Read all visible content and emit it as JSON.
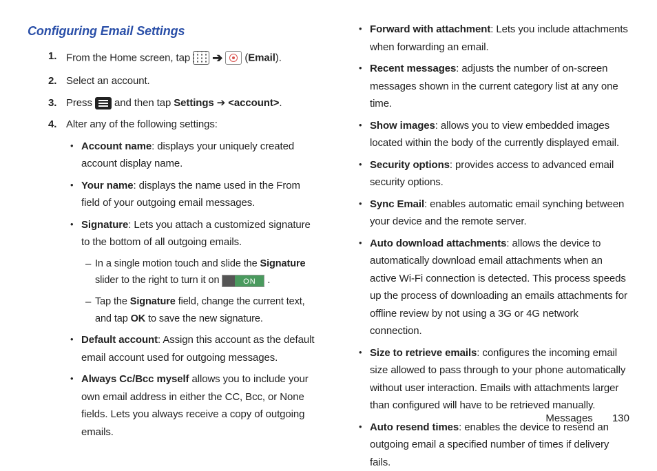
{
  "heading": "Configuring Email Settings",
  "steps": {
    "s1_pre": "From the Home screen, tap ",
    "s1_mid": " (",
    "s1_bold": "Email",
    "s1_end": ").",
    "s2": "Select an account.",
    "s3_pre": "Press ",
    "s3_mid": " and then tap ",
    "s3_settings": "Settings",
    "s3_arrow": " ➔ ",
    "s3_account": "<account>",
    "s3_end": ".",
    "s4": "Alter any of the following settings:"
  },
  "arrow": "➔",
  "on_label": "ON",
  "col1_bullets": [
    {
      "bold": "Account name",
      "rest": ": displays your uniquely created account display name."
    },
    {
      "bold": "Your name",
      "rest": ": displays the name used in the From field of your outgoing email messages."
    },
    {
      "bold": "Signature",
      "rest": ": Lets you attach a customized signature to the bottom of all outgoing emails."
    }
  ],
  "dashes": {
    "d1_pre": "In a single motion touch and slide the ",
    "d1_bold": "Signature",
    "d1_mid": " slider to the right to turn it on  ",
    "d1_end": " .",
    "d2_pre": "Tap the ",
    "d2_bold1": "Signature",
    "d2_mid": " field, change the current text, and tap ",
    "d2_bold2": "OK",
    "d2_end": " to save the new signature."
  },
  "col1_bullets2": [
    {
      "bold": "Default account",
      "rest": ": Assign this account as the default email account used for outgoing messages."
    },
    {
      "bold": "Always Cc/Bcc myself",
      "rest": " allows you to include your own email address in either the CC, Bcc, or None fields. Lets you always receive a copy of outgoing emails."
    }
  ],
  "col2_bullets": [
    {
      "bold": "Forward with attachment",
      "rest": ": Lets you include attachments when forwarding an email."
    },
    {
      "bold": "Recent messages",
      "rest": ": adjusts the number of on-screen messages shown in the current category list at any one time."
    },
    {
      "bold": "Show images",
      "rest": ": allows you to view embedded images located within the body of the currently displayed email."
    },
    {
      "bold": "Security options",
      "rest": ": provides access to advanced email security options."
    },
    {
      "bold": "Sync Email",
      "rest": ": enables automatic email synching between your device and the remote server."
    },
    {
      "bold": "Auto download attachments",
      "rest": ": allows the device to automatically download email attachments when an active Wi-Fi connection is detected. This process speeds up the process of downloading an emails attachments for offline review by not using a 3G or 4G network connection."
    },
    {
      "bold": "Size to retrieve emails",
      "rest": ": configures the incoming email size allowed to pass through to your phone automatically without user interaction. Emails with attachments larger than configured will have to be retrieved manually."
    },
    {
      "bold": "Auto resend times",
      "rest": ": enables the device to resend an outgoing email a specified number of times if delivery fails."
    }
  ],
  "footer": {
    "section": "Messages",
    "page": "130"
  }
}
